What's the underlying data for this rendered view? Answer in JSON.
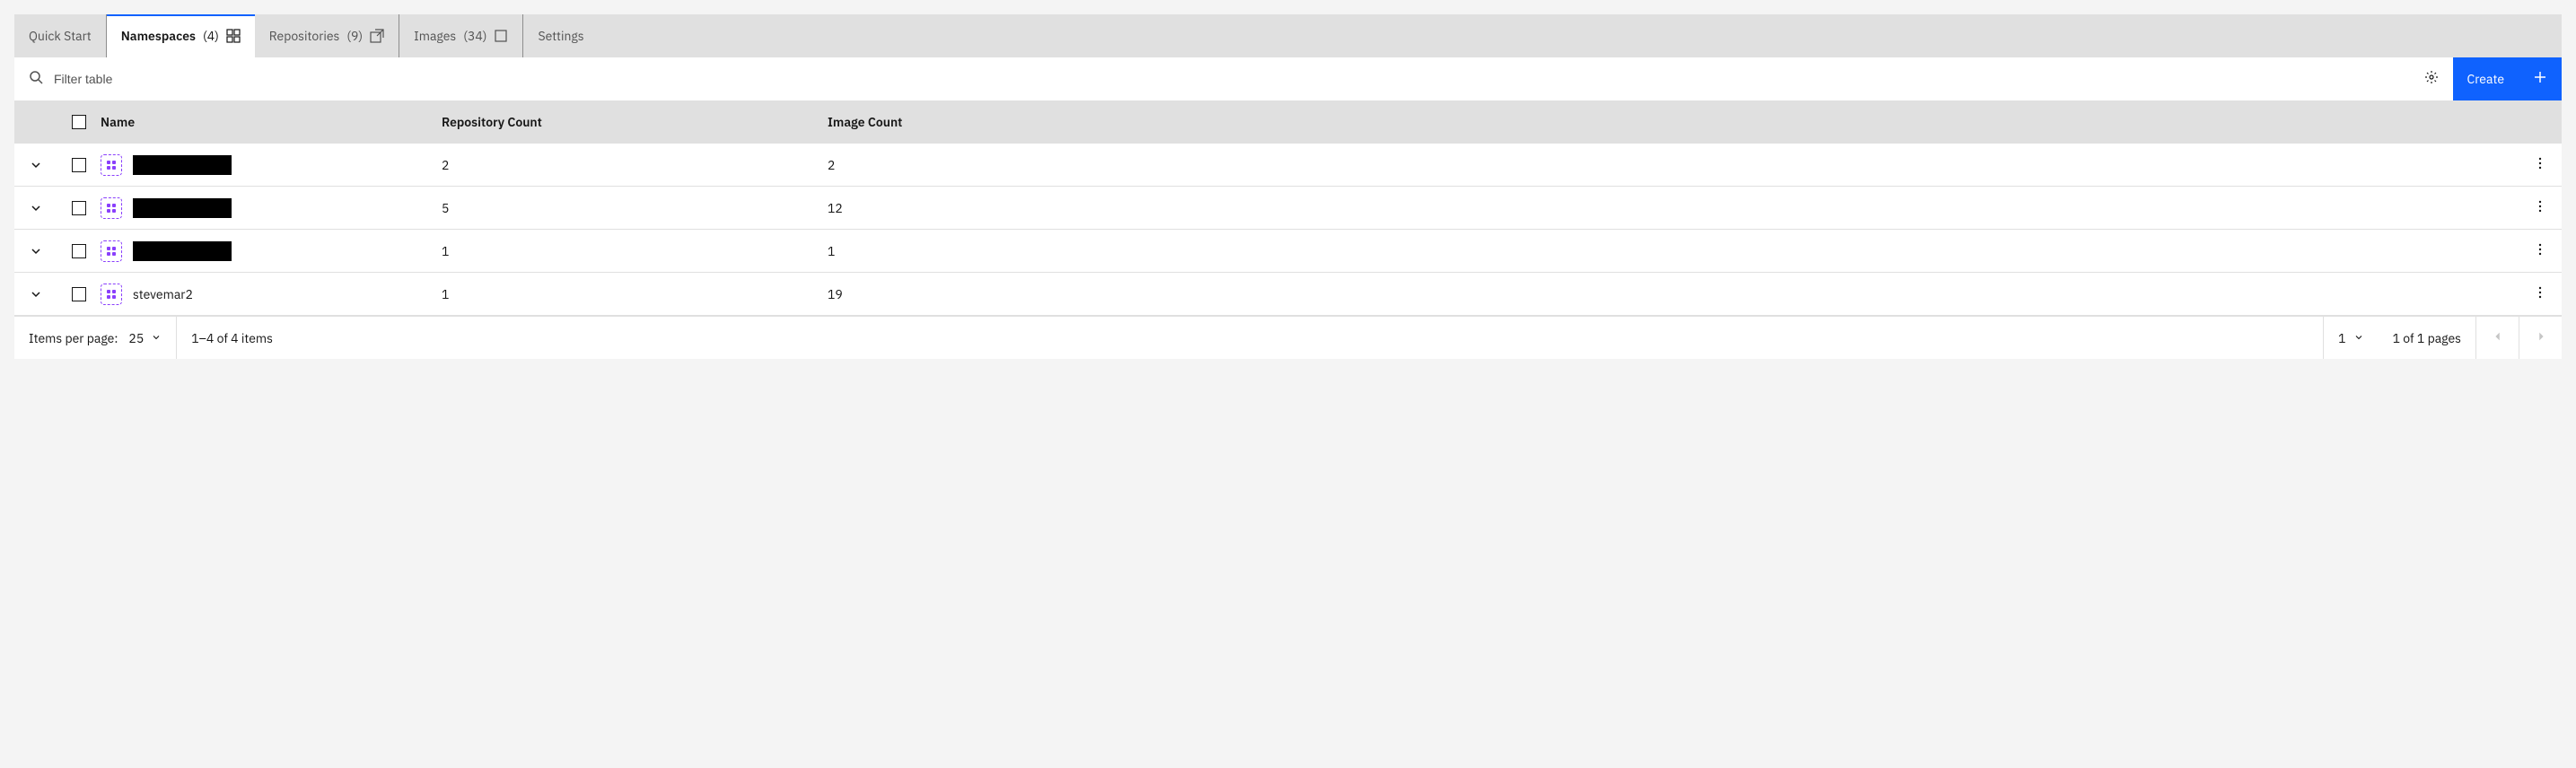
{
  "tabs": [
    {
      "label": "Quick Start",
      "count": null,
      "icon": null
    },
    {
      "label": "Namespaces",
      "count": "(4)",
      "icon": "grid"
    },
    {
      "label": "Repositories",
      "count": "(9)",
      "icon": "launch"
    },
    {
      "label": "Images",
      "count": "(34)",
      "icon": "square"
    },
    {
      "label": "Settings",
      "count": null,
      "icon": null
    }
  ],
  "toolbar": {
    "search_placeholder": "Filter table",
    "create_label": "Create"
  },
  "columns": {
    "name": "Name",
    "repo": "Repository Count",
    "image": "Image Count"
  },
  "rows": [
    {
      "name": "",
      "redacted": true,
      "repo_count": "2",
      "image_count": "2"
    },
    {
      "name": "",
      "redacted": true,
      "repo_count": "5",
      "image_count": "12"
    },
    {
      "name": "",
      "redacted": true,
      "repo_count": "1",
      "image_count": "1"
    },
    {
      "name": "stevemar2",
      "redacted": false,
      "repo_count": "1",
      "image_count": "19"
    }
  ],
  "pagination": {
    "items_per_page_label": "Items per page:",
    "items_per_page_value": "25",
    "range_text": "1–4 of 4 items",
    "page_value": "1",
    "pages_text": "1 of 1 pages"
  }
}
